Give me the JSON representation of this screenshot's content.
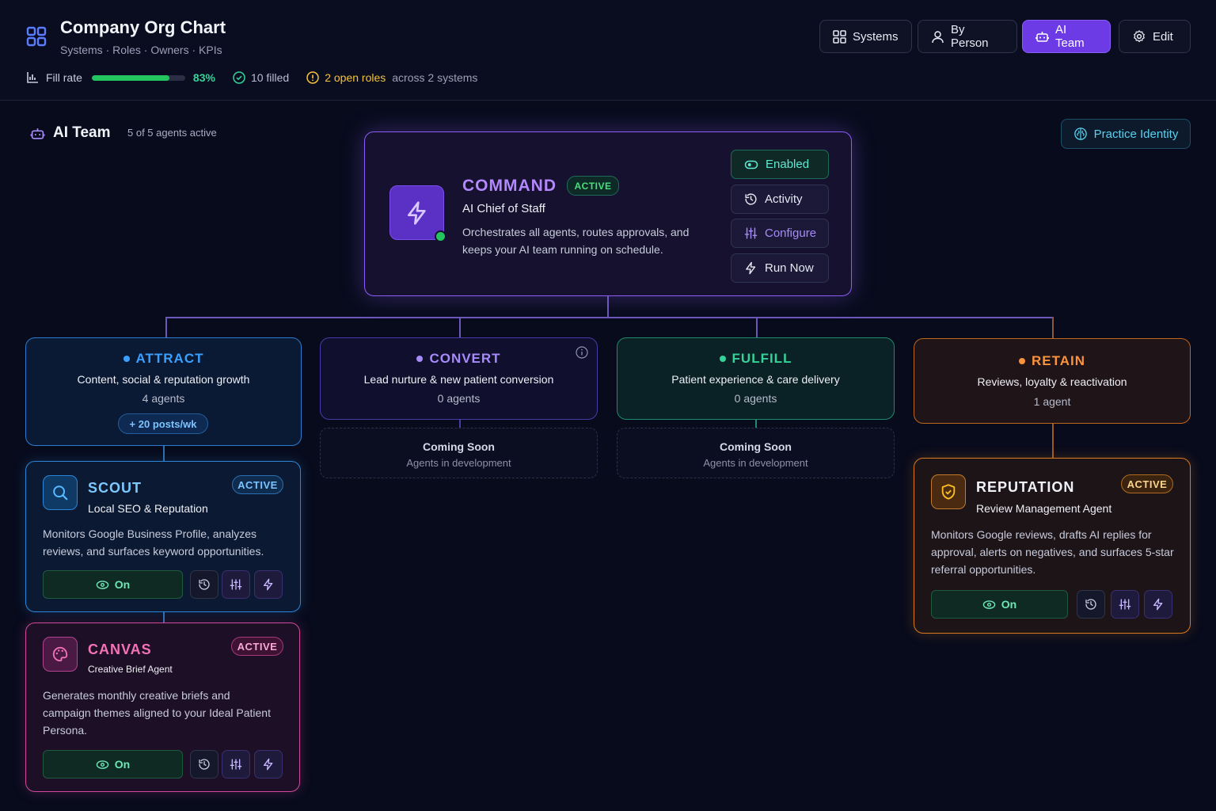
{
  "header": {
    "title": "Company Org Chart",
    "subtitle": "Systems · Roles · Owners · KPIs",
    "fill_rate_label": "Fill rate",
    "fill_rate_value": "83%",
    "fill_rate_fraction": 0.83,
    "filled_text": "10 filled",
    "open_roles_text": "2 open roles",
    "across_text": "across 2 systems",
    "nav": {
      "systems": "Systems",
      "by_person": "By Person",
      "ai_team": "AI Team",
      "edit": "Edit"
    }
  },
  "section": {
    "title": "AI Team",
    "subtitle": "5 of 5 agents active",
    "practice_identity": "Practice Identity"
  },
  "command": {
    "name": "COMMAND",
    "badge": "ACTIVE",
    "role": "AI Chief of Staff",
    "description": "Orchestrates all agents, routes approvals, and keeps your AI team running on schedule.",
    "buttons": {
      "enabled": "Enabled",
      "activity": "Activity",
      "configure": "Configure",
      "run_now": "Run Now"
    }
  },
  "categories": {
    "attract": {
      "name": "ATTRACT",
      "description": "Content, social & reputation growth",
      "count": "4 agents",
      "kpi": "+ 20 posts/wk",
      "color": "#3aa0ff"
    },
    "convert": {
      "name": "CONVERT",
      "description": "Lead nurture & new patient conversion",
      "count": "0 agents",
      "color": "#a78bfa"
    },
    "fulfill": {
      "name": "FULFILL",
      "description": "Patient experience & care delivery",
      "count": "0 agents",
      "color": "#34d399"
    },
    "retain": {
      "name": "RETAIN",
      "description": "Reviews, loyalty & reactivation",
      "count": "1 agent",
      "color": "#fb923c"
    }
  },
  "coming_soon": {
    "title": "Coming Soon",
    "subtitle": "Agents in development"
  },
  "agents": {
    "scout": {
      "name": "SCOUT",
      "badge": "ACTIVE",
      "role": "Local SEO & Reputation",
      "description": "Monitors Google Business Profile, analyzes reviews, and surfaces keyword opportunities.",
      "toggle": "On"
    },
    "canvas": {
      "name": "CANVAS",
      "badge": "ACTIVE",
      "role": "Creative Brief Agent",
      "description": "Generates monthly creative briefs and campaign themes aligned to your Ideal Patient Persona.",
      "toggle": "On"
    },
    "reputation": {
      "name": "REPUTATION",
      "badge": "ACTIVE",
      "role": "Review Management Agent",
      "description": "Monitors Google reviews, drafts AI replies for approval, alerts on negatives, and surfaces 5-star referral opportunities.",
      "toggle": "On"
    }
  }
}
